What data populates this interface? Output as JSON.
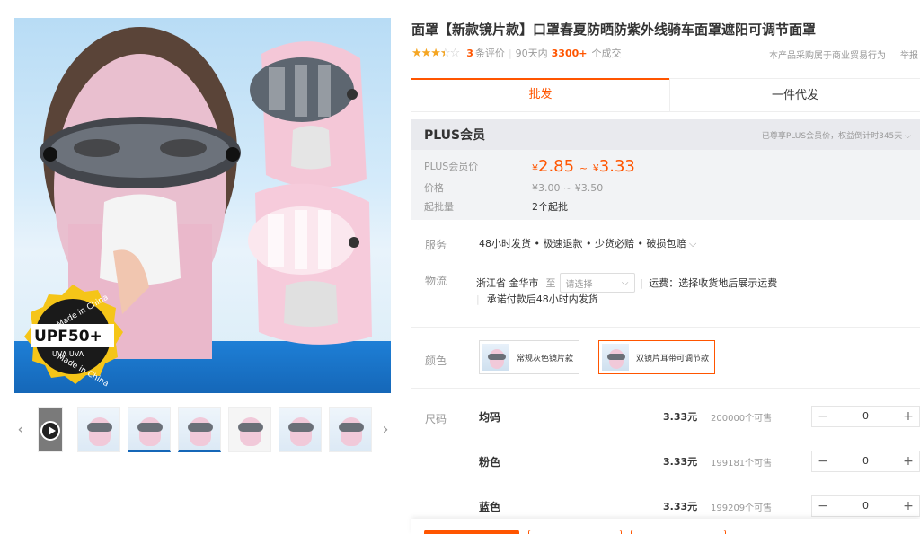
{
  "product": {
    "title": "面罩【新款镜片款】口罩春夏防晒防紫外线骑车面罩遮阳可调节面罩",
    "rating_stars": 3.5,
    "review_count": "3",
    "review_label": "条评价",
    "sales_prefix": "90天内",
    "sales_count": "3300+",
    "sales_suffix": "个成交",
    "notice": "本产品采购属于商业贸易行为",
    "notice_cut": "举报"
  },
  "badge": {
    "top": "Made in China",
    "main": "UPF50+",
    "sub": "UVA UVA",
    "bottom": "Made in China"
  },
  "tabs": [
    {
      "label": "批发",
      "active": true
    },
    {
      "label": "一件代发",
      "active": false
    }
  ],
  "price_box": {
    "title": "PLUS会员",
    "note": "已尊享PLUS会员价，权益倒计时345天",
    "plus_label": "PLUS会员价",
    "plus_low": "2.85",
    "plus_high": "3.33",
    "currency": "¥",
    "tilde": "~",
    "price_label": "价格",
    "price_range": "¥3.00 ~ ¥3.50",
    "moq_label": "起批量",
    "moq_value": "2个起批"
  },
  "service": {
    "label": "服务",
    "text": "48小时发货 • 极速退款 • 少货必赔 • 破损包赔"
  },
  "logistics": {
    "label": "物流",
    "origin": "浙江省 金华市",
    "to": "至",
    "select_placeholder": "请选择",
    "freight": "运费：选择收货地后展示运费",
    "promise": "承诺付款后48小时内发货"
  },
  "colors": {
    "label": "颜色",
    "options": [
      {
        "label": "常规灰色镜片款",
        "selected": false
      },
      {
        "label": "双镜片耳带可调节款",
        "selected": true
      }
    ]
  },
  "sizes": {
    "label": "尺码",
    "rows": [
      {
        "name": "均码",
        "price": "3.33元",
        "stock": "200000个可售",
        "qty": "0"
      },
      {
        "name": "粉色",
        "price": "3.33元",
        "stock": "199181个可售",
        "qty": "0"
      },
      {
        "name": "蓝色",
        "price": "3.33元",
        "stock": "199209个可售",
        "qty": "0"
      }
    ]
  },
  "icons": {
    "minus": "−",
    "plus": "+",
    "left": "‹",
    "right": "›",
    "chevron": "⌵"
  },
  "accent_color": "#ff5500"
}
